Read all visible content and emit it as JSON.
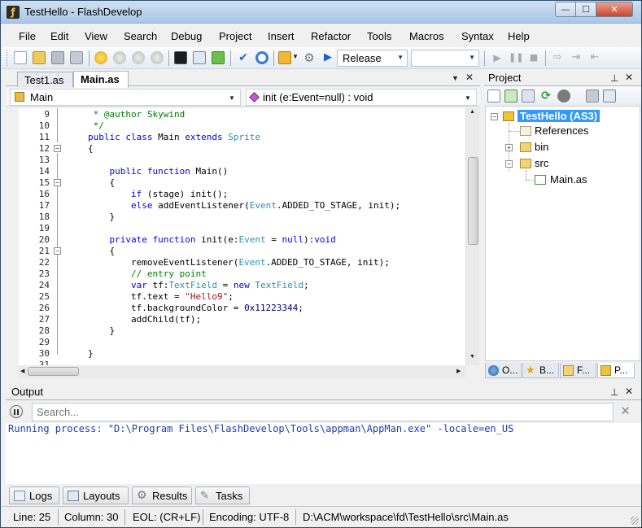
{
  "window": {
    "title": "TestHello - FlashDevelop",
    "minimize_label": "—",
    "maximize_label": "☐",
    "close_label": "✕"
  },
  "menu": [
    "File",
    "Edit",
    "View",
    "Search",
    "Debug",
    "Project",
    "Insert",
    "Refactor",
    "Tools",
    "Macros",
    "Syntax",
    "Help"
  ],
  "toolbar": {
    "icons": [
      "new-file-icon",
      "open-file-icon",
      "save-icon",
      "save-all-icon",
      "bookmark-icon",
      "bookmark-prev-icon",
      "bookmark-next-icon",
      "bookmark-clear-icon",
      "command-prompt-icon",
      "panel-icon",
      "plugin-icon",
      "check-syntax-icon",
      "clock-icon",
      "package-icon",
      "gear-icon",
      "run-icon"
    ],
    "config": "Release",
    "target": "",
    "debug_icons": [
      "debug-continue-icon",
      "debug-pause-icon",
      "debug-stop-icon",
      "step-over-icon",
      "step-into-icon",
      "step-out-icon"
    ]
  },
  "editor": {
    "tabs": [
      {
        "label": "Test1.as",
        "active": false
      },
      {
        "label": "Main.as",
        "active": true
      }
    ],
    "nav_class": "Main",
    "nav_member": "init (e:Event=null) : void",
    "lines": [
      {
        "num": "9",
        "text": " * @author Skywind"
      },
      {
        "num": "10",
        "text": " */"
      },
      {
        "num": "11",
        "text": "public class Main extends Sprite"
      },
      {
        "num": "12",
        "text": "{"
      },
      {
        "num": "13",
        "text": ""
      },
      {
        "num": "14",
        "text": "    public function Main()"
      },
      {
        "num": "15",
        "text": "    {"
      },
      {
        "num": "16",
        "text": "        if (stage) init();"
      },
      {
        "num": "17",
        "text": "        else addEventListener(Event.ADDED_TO_STAGE, init);"
      },
      {
        "num": "18",
        "text": "    }"
      },
      {
        "num": "19",
        "text": ""
      },
      {
        "num": "20",
        "text": "    private function init(e:Event = null):void"
      },
      {
        "num": "21",
        "text": "    {"
      },
      {
        "num": "22",
        "text": "        removeEventListener(Event.ADDED_TO_STAGE, init);"
      },
      {
        "num": "23",
        "text": "        // entry point"
      },
      {
        "num": "24",
        "text": "        var tf:TextField = new TextField;"
      },
      {
        "num": "25",
        "text": "        tf.text = \"Hello9\";"
      },
      {
        "num": "26",
        "text": "        tf.backgroundColor = 0x11223344;"
      },
      {
        "num": "27",
        "text": "        addChild(tf);"
      },
      {
        "num": "28",
        "text": "    }"
      },
      {
        "num": "29",
        "text": ""
      },
      {
        "num": "30",
        "text": "}"
      },
      {
        "num": "31",
        "text": ""
      }
    ]
  },
  "project": {
    "title": "Project",
    "tree": [
      {
        "label": "TestHello (AS3)",
        "selected": true
      },
      {
        "label": "References"
      },
      {
        "label": "bin"
      },
      {
        "label": "src"
      },
      {
        "label": "Main.as"
      }
    ],
    "side_tabs": [
      "O...",
      "B...",
      "F...",
      "P..."
    ]
  },
  "output": {
    "title": "Output",
    "search_placeholder": "Search...",
    "text": "Running process: \"D:\\Program Files\\FlashDevelop\\Tools\\appman\\AppMan.exe\" -locale=en_US"
  },
  "bottom_tabs": [
    "Logs",
    "Layouts",
    "Results",
    "Tasks"
  ],
  "status": {
    "line": "Line: 25",
    "column": "Column: 30",
    "eol": "EOL: (CR+LF)",
    "encoding": "Encoding: UTF-8",
    "path": "D:\\ACM\\workspace\\fd\\TestHello\\src\\Main.as"
  },
  "colors": {
    "keyword": "#0000ff",
    "type": "#2b91af",
    "comment": "#008000",
    "string": "#a31515",
    "number": "#000080",
    "selection": "#3399ff"
  }
}
